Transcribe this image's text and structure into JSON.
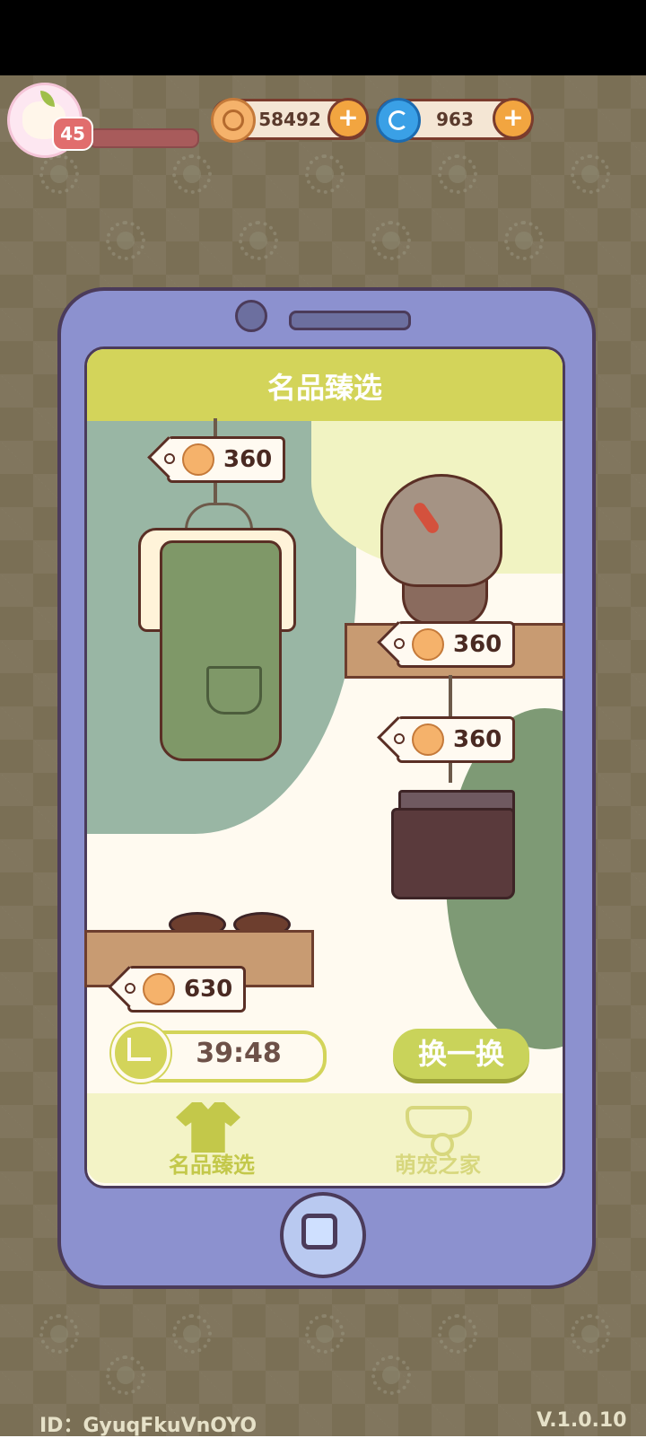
{
  "player": {
    "level": "45"
  },
  "currencies": {
    "coins": "58492",
    "gems": "963",
    "add_symbol": "+"
  },
  "shop": {
    "title": "名品臻选",
    "items": [
      {
        "name": "apron",
        "price": "360"
      },
      {
        "name": "wig",
        "price": "360"
      },
      {
        "name": "shorts",
        "price": "360"
      },
      {
        "name": "sandals",
        "price": "630"
      }
    ],
    "timer": "39:48",
    "refresh_label": "换一换"
  },
  "nav": {
    "tab_shop": "名品臻选",
    "tab_pet": "萌宠之家"
  },
  "footer": {
    "id_text": "ID：GyuqFkuVnOYO",
    "version": "V.1.0.10"
  },
  "colors": {
    "accent": "#d3d45a",
    "phone": "#8c91cf",
    "outline": "#4b3b5a",
    "nav_active": "#c3c84a",
    "nav_inactive": "#d7d77d"
  }
}
